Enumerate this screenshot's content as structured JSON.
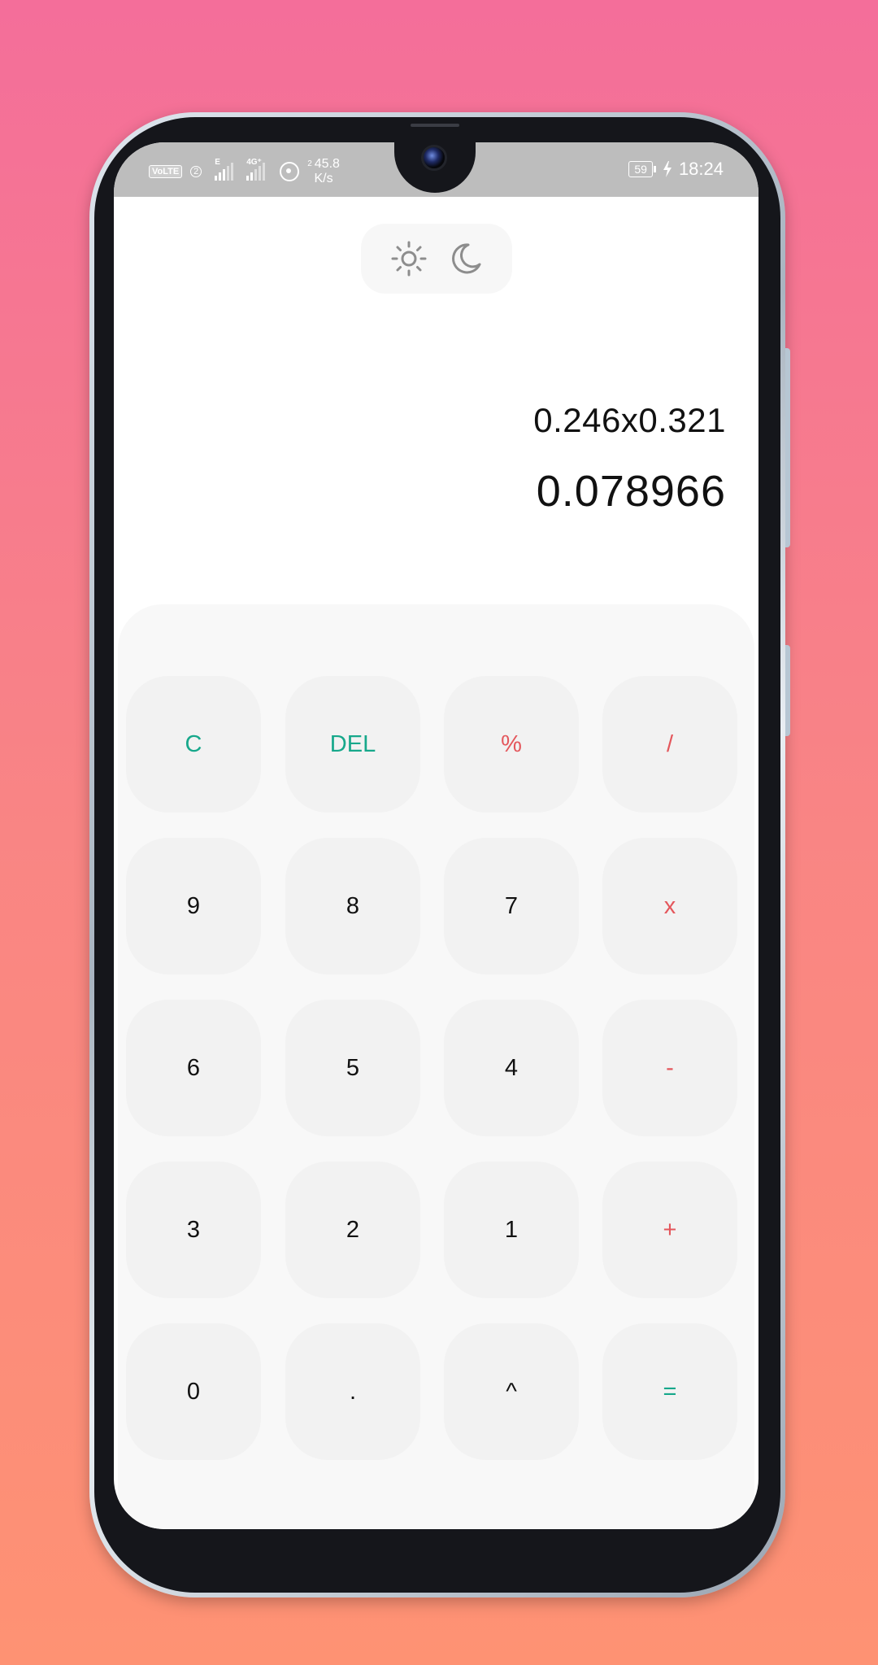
{
  "status_bar": {
    "volte": "VoLTE",
    "sim": "2",
    "network_1": "E",
    "network_2": "4G⁺",
    "speed_top": "2",
    "speed_value": "45.8",
    "speed_unit": "K/s",
    "battery": "59",
    "time": "18:24"
  },
  "theme_toggle": {
    "light_icon": "sun-icon",
    "dark_icon": "moon-icon"
  },
  "display": {
    "expression": "0.246x0.321",
    "result": "0.078966"
  },
  "colors": {
    "accent_teal": "#17a88b",
    "accent_red": "#e4575c",
    "key_bg": "#f2f2f2",
    "keypad_bg": "#f8f8f8"
  },
  "keypad": {
    "rows": [
      [
        {
          "label": "C",
          "name": "clear-button",
          "style": "teal"
        },
        {
          "label": "DEL",
          "name": "delete-button",
          "style": "teal"
        },
        {
          "label": "%",
          "name": "percent-button",
          "style": "red"
        },
        {
          "label": "/",
          "name": "divide-button",
          "style": "red"
        }
      ],
      [
        {
          "label": "9",
          "name": "digit-9-button",
          "style": "plain"
        },
        {
          "label": "8",
          "name": "digit-8-button",
          "style": "plain"
        },
        {
          "label": "7",
          "name": "digit-7-button",
          "style": "plain"
        },
        {
          "label": "x",
          "name": "multiply-button",
          "style": "red"
        }
      ],
      [
        {
          "label": "6",
          "name": "digit-6-button",
          "style": "plain"
        },
        {
          "label": "5",
          "name": "digit-5-button",
          "style": "plain"
        },
        {
          "label": "4",
          "name": "digit-4-button",
          "style": "plain"
        },
        {
          "label": "-",
          "name": "subtract-button",
          "style": "red"
        }
      ],
      [
        {
          "label": "3",
          "name": "digit-3-button",
          "style": "plain"
        },
        {
          "label": "2",
          "name": "digit-2-button",
          "style": "plain"
        },
        {
          "label": "1",
          "name": "digit-1-button",
          "style": "plain"
        },
        {
          "label": "+",
          "name": "add-button",
          "style": "red"
        }
      ],
      [
        {
          "label": "0",
          "name": "digit-0-button",
          "style": "plain"
        },
        {
          "label": ".",
          "name": "decimal-button",
          "style": "plain"
        },
        {
          "label": "^",
          "name": "power-button",
          "style": "plain"
        },
        {
          "label": "=",
          "name": "equals-button",
          "style": "teal"
        }
      ]
    ]
  }
}
